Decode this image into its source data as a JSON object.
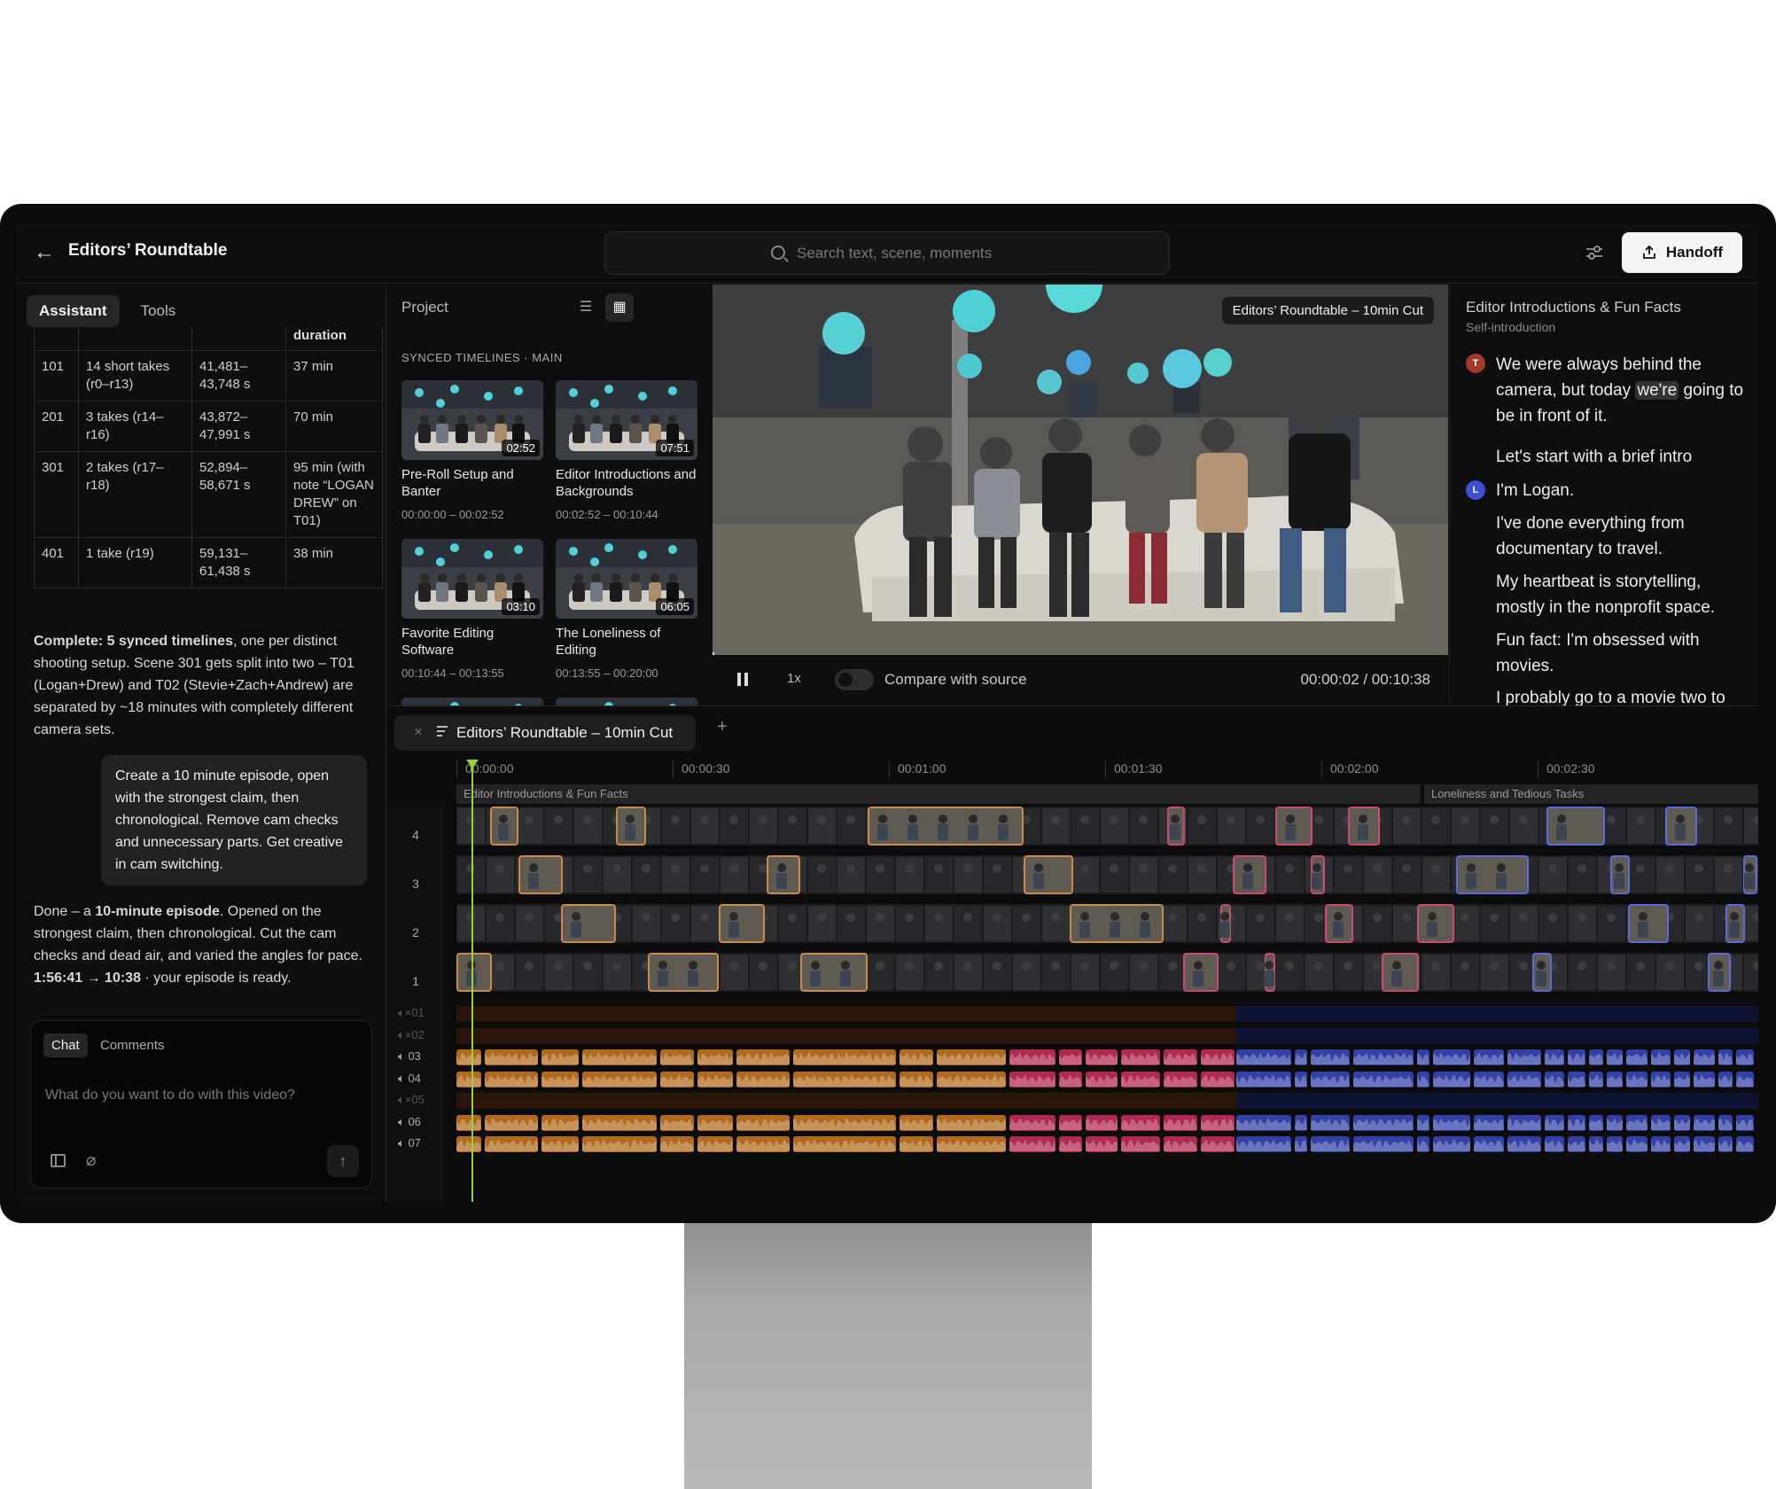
{
  "header": {
    "title": "Editors’ Roundtable",
    "search_placeholder": "Search text, scene, moments",
    "handoff_label": "Handoff"
  },
  "left_panel": {
    "tabs": [
      "Assistant",
      "Tools"
    ],
    "table": {
      "header_fragment": "duration",
      "rows": [
        {
          "scene": "101",
          "takes": "14 short takes (r0–r13)",
          "range": "41,481–43,748 s",
          "duration": "37 min"
        },
        {
          "scene": "201",
          "takes": "3 takes (r14–r16)",
          "range": "43,872–47,991 s",
          "duration": "70 min"
        },
        {
          "scene": "301",
          "takes": "2 takes (r17–r18)",
          "range": "52,894–58,671 s",
          "duration": "95 min (with note “LOGAN DREW” on T01)"
        },
        {
          "scene": "401",
          "takes": "1 take (r19)",
          "range": "59,131–61,438 s",
          "duration": "38 min"
        }
      ]
    },
    "assistant_msg_1_bold": "Complete: 5 synced timelines",
    "assistant_msg_1_rest": ", one per distinct shooting setup. Scene 301 gets split into two – T01 (Logan+Drew) and T02 (Stevie+Zach+Andrew) are separated by ~18 minutes with completely different camera sets.",
    "user_msg": "Create a 10 minute episode, open with the strongest claim, then chronological. Remove cam checks and unnecessary parts. Get creative in cam switching.",
    "assistant_msg_2_a": "Done – a ",
    "assistant_msg_2_b": "10-minute episode",
    "assistant_msg_2_c": ". Opened on the strongest claim, then chronological. Cut the cam checks and dead air, and varied the angles for pace. ",
    "assistant_msg_2_d": "1:56:41 → 10:38",
    "assistant_msg_2_e": " · your episode is ready.",
    "chat_tabs": [
      "Chat",
      "Comments"
    ],
    "chat_placeholder": "What do you want to do with this video?"
  },
  "project": {
    "title": "Project",
    "section_label": "SYNCED TIMELINES · MAIN",
    "cards": [
      {
        "title": "Pre-Roll Setup and Banter",
        "duration": "02:52",
        "range": "00:00:00 – 00:02:52"
      },
      {
        "title": "Editor Introductions and Backgrounds",
        "duration": "07:51",
        "range": "00:02:52 – 00:10:44"
      },
      {
        "title": "Favorite Editing Software",
        "duration": "03:10",
        "range": "00:10:44 – 00:13:55"
      },
      {
        "title": "The Loneliness of Editing",
        "duration": "06:05",
        "range": "00:13:55 – 00:20:00"
      }
    ]
  },
  "player": {
    "badge": "Editors’ Roundtable – 10min Cut",
    "speed": "1x",
    "compare_label": "Compare with source",
    "timecode": "00:00:02 / 00:10:38",
    "progress": 0.003
  },
  "transcript": {
    "title": "Editor Introductions & Fun Facts",
    "subtitle": "Self-introduction",
    "blocks": [
      {
        "speaker": "T",
        "color": "#a33a2e",
        "lines": [
          "We were always behind the camera, but today",
          "we're",
          "going to be in front of it.",
          "Let's start with a brief intro"
        ]
      },
      {
        "speaker": "L",
        "color": "#3b4fd0",
        "lines": [
          "I'm Logan.",
          "I've done everything from documentary to travel.",
          "My heartbeat is storytelling, mostly in the nonprofit space.",
          "Fun fact: I'm obsessed with movies.",
          "I probably go to a movie two to three times a week."
        ]
      }
    ]
  },
  "timeline": {
    "tab_name": "Editors’ Roundtable – 10min Cut",
    "ruler": [
      "00:00:00",
      "00:00:30",
      "00:01:00",
      "00:01:30",
      "00:02:00",
      "00:02:30"
    ],
    "scenes": [
      "Editor Introductions & Fun Facts",
      "Loneliness and Tedious Tasks"
    ],
    "video_tracks": [
      "4",
      "3",
      "2",
      "1"
    ],
    "audio_tracks": [
      {
        "label": "01",
        "muted": true
      },
      {
        "label": "02",
        "muted": true
      },
      {
        "label": "03",
        "muted": false
      },
      {
        "label": "04",
        "muted": false
      },
      {
        "label": "05",
        "muted": true
      },
      {
        "label": "06",
        "muted": false
      },
      {
        "label": "07",
        "muted": false
      }
    ],
    "colors": {
      "orange": "#b06a1e",
      "pink": "#b0294f",
      "blue": "#3340a6"
    }
  }
}
